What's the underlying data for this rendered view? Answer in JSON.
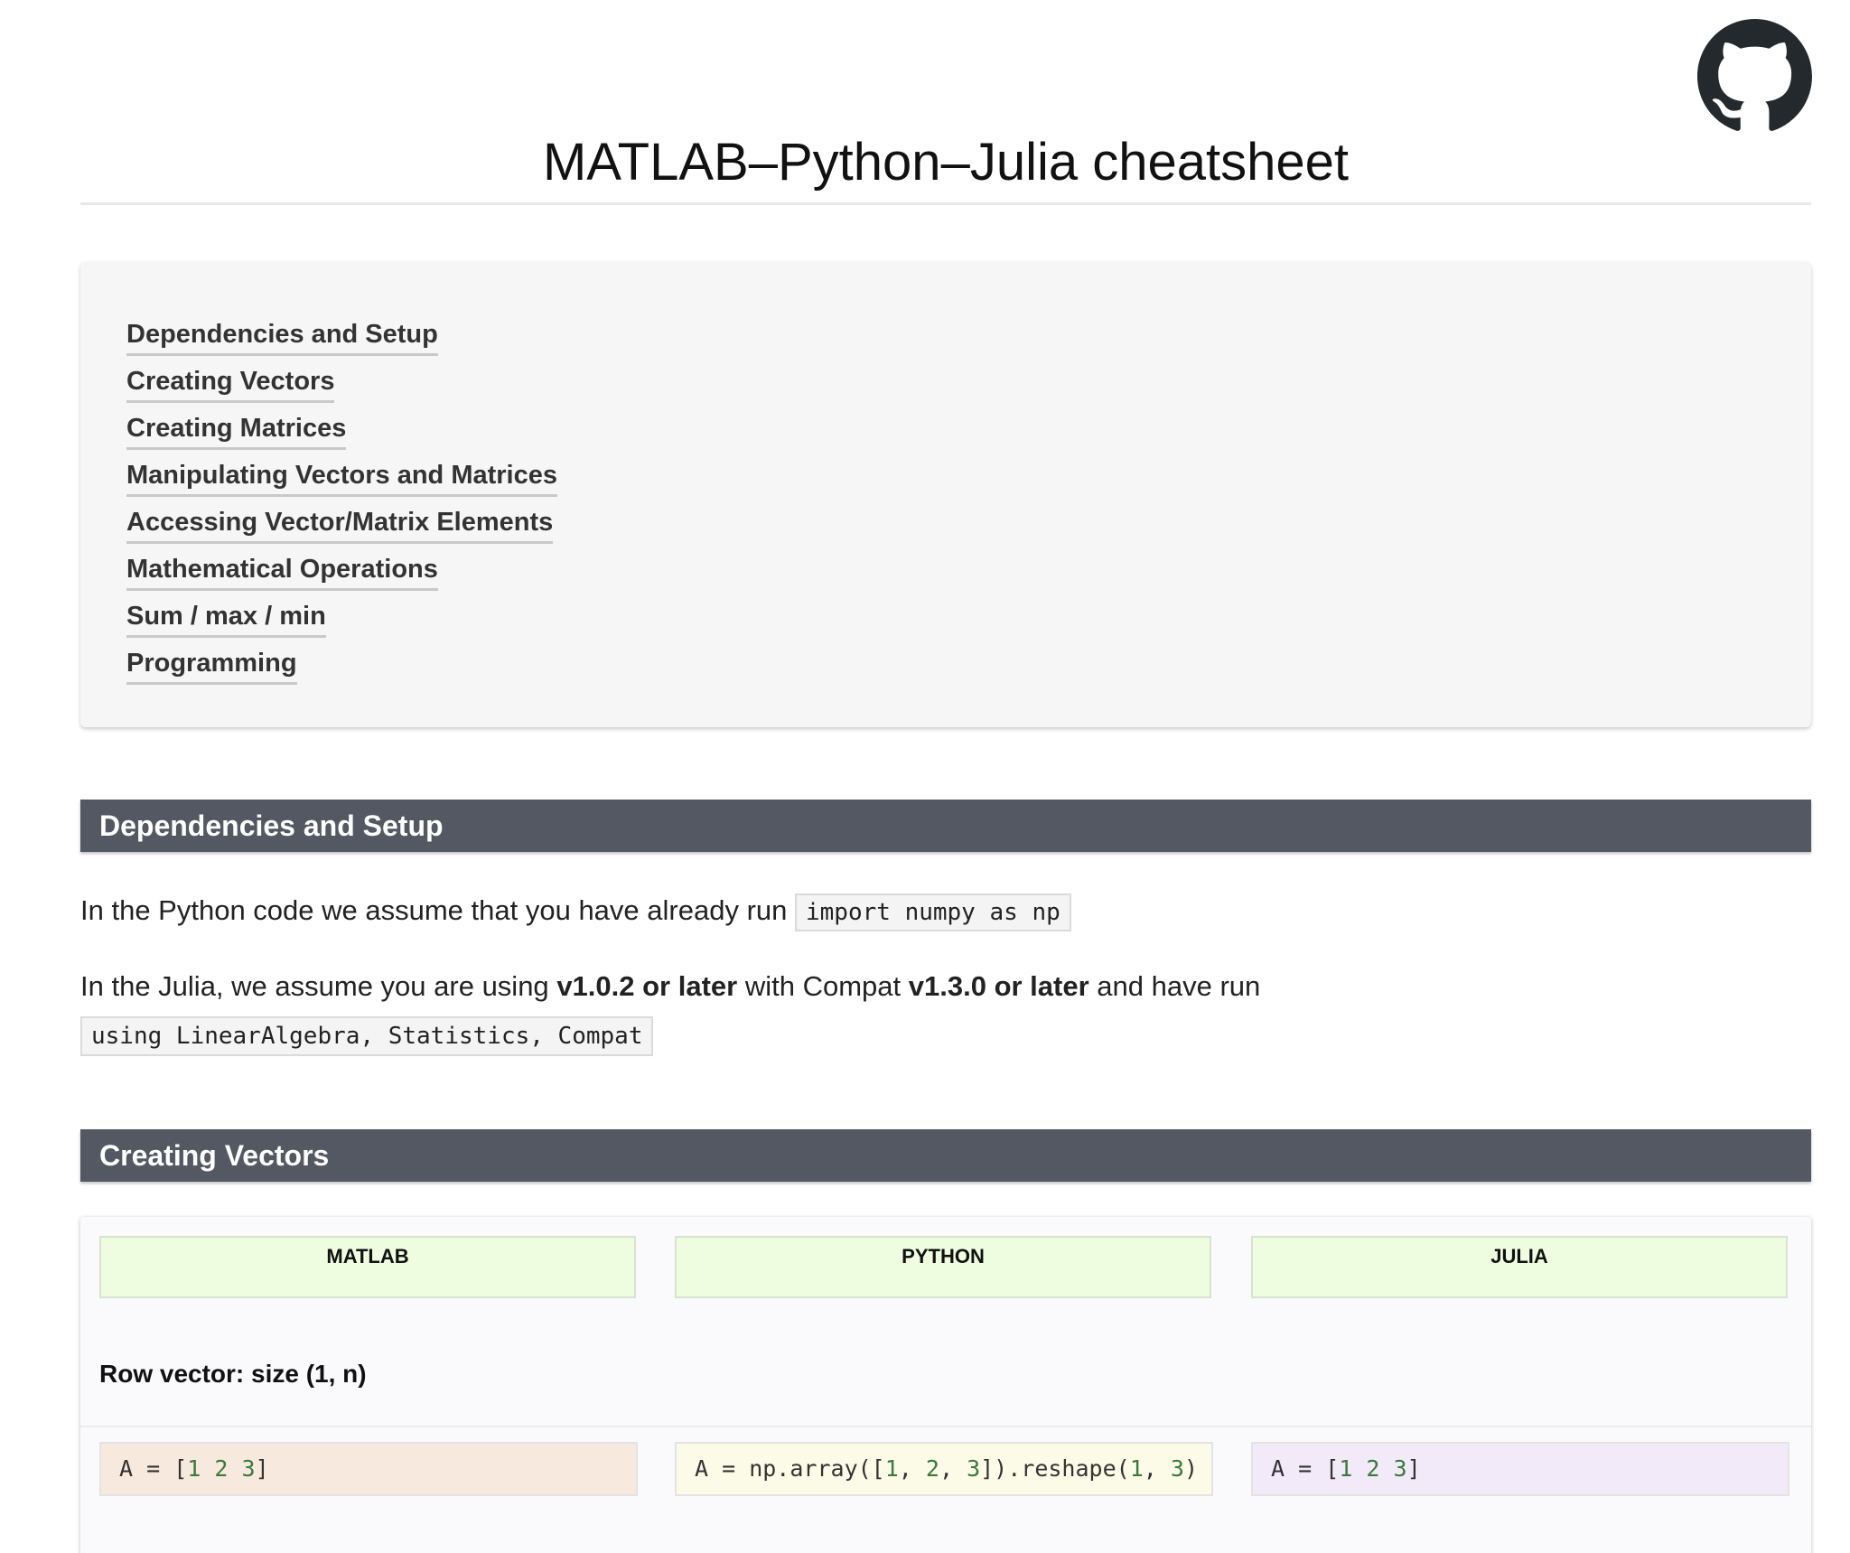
{
  "page": {
    "title": "MATLAB–Python–Julia cheatsheet"
  },
  "github": {
    "icon": "github-icon"
  },
  "toc": {
    "items": [
      {
        "label": "Dependencies and Setup"
      },
      {
        "label": "Creating Vectors"
      },
      {
        "label": "Creating Matrices"
      },
      {
        "label": "Manipulating Vectors and Matrices"
      },
      {
        "label": "Accessing Vector/Matrix Elements"
      },
      {
        "label": "Mathematical Operations"
      },
      {
        "label": "Sum / max / min"
      },
      {
        "label": "Programming"
      }
    ]
  },
  "sections": {
    "setup": {
      "title": "Dependencies and Setup",
      "python_text": "In the Python code we assume that you have already run",
      "python_code": "import numpy as np",
      "julia_text_1": "In the Julia, we assume you are using",
      "julia_bold_1": "v1.0.2 or later",
      "julia_text_2": "with Compat",
      "julia_bold_2": "v1.3.0 or later",
      "julia_text_3": "and have run",
      "julia_code": "using LinearAlgebra, Statistics, Compat"
    },
    "vectors": {
      "title": "Creating Vectors",
      "headers": {
        "matlab": "MATLAB",
        "python": "PYTHON",
        "julia": "JULIA"
      },
      "rows": [
        {
          "title": "Row vector: size (1, n)",
          "matlab": "A = [1 2 3]",
          "python": "A = np.array([1, 2, 3]).reshape(1, 3)",
          "julia": "A = [1 2 3]"
        }
      ]
    }
  },
  "colors": {
    "section_header_bg": "#535862",
    "lang_header_bg": "#eefde0",
    "matlab_code_bg": "#f8e9de",
    "python_code_bg": "#fcfbe8",
    "julia_code_bg": "#f2eaf8",
    "toc_bg": "#f6f6f7"
  }
}
